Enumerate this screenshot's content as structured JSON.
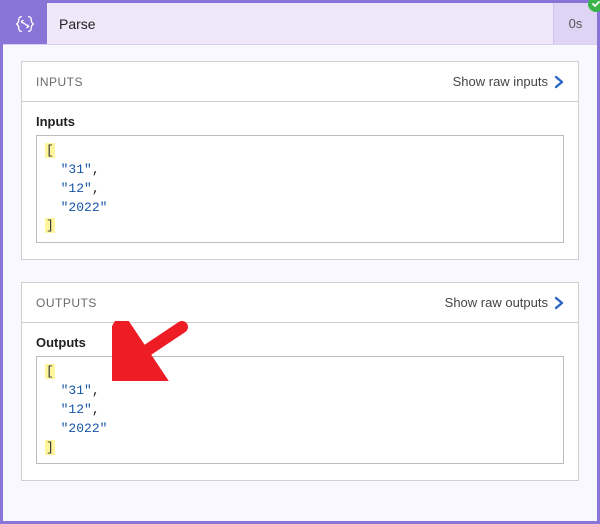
{
  "header": {
    "title": "Parse",
    "elapsed": "0s"
  },
  "inputs_card": {
    "title": "INPUTS",
    "raw_link": "Show raw inputs",
    "subhead": "Inputs",
    "values": [
      "31",
      "12",
      "2022"
    ]
  },
  "outputs_card": {
    "title": "OUTPUTS",
    "raw_link": "Show raw outputs",
    "subhead": "Outputs",
    "values": [
      "31",
      "12",
      "2022"
    ]
  },
  "colors": {
    "accent": "#8974d8",
    "link_chevron": "#2b66c4",
    "arrow": "#ee1c25"
  }
}
